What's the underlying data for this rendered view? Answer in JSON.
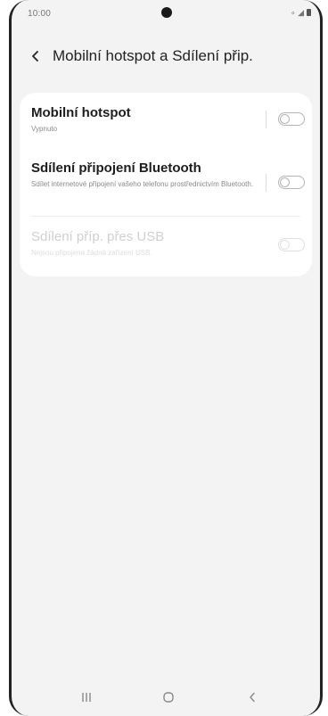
{
  "status_bar": {
    "time": "10:00",
    "signal_icons": "∘ ◢"
  },
  "header": {
    "title": "Mobilní hotspot a Sdílení přip."
  },
  "settings": [
    {
      "title": "Mobilní hotspot",
      "subtitle": "Vypnuto",
      "enabled": true,
      "toggle_on": false
    },
    {
      "title": "Sdílení připojení Bluetooth",
      "subtitle": "Sdílet internetové připojení vašeho telefonu prostřednictvím Bluetooth.",
      "enabled": true,
      "toggle_on": false
    },
    {
      "title": "Sdílení příp. přes USB",
      "subtitle": "Nejsou připojena žádná zařízení USB.",
      "enabled": false,
      "toggle_on": false
    }
  ],
  "colors": {
    "background": "#f3f3f3",
    "card": "#ffffff",
    "toggle_off": "#b4b4b4"
  },
  "icons": {
    "back": "chevron-left-icon",
    "nav_recent": "recent-apps-icon",
    "nav_home": "home-icon",
    "nav_back": "back-icon"
  }
}
